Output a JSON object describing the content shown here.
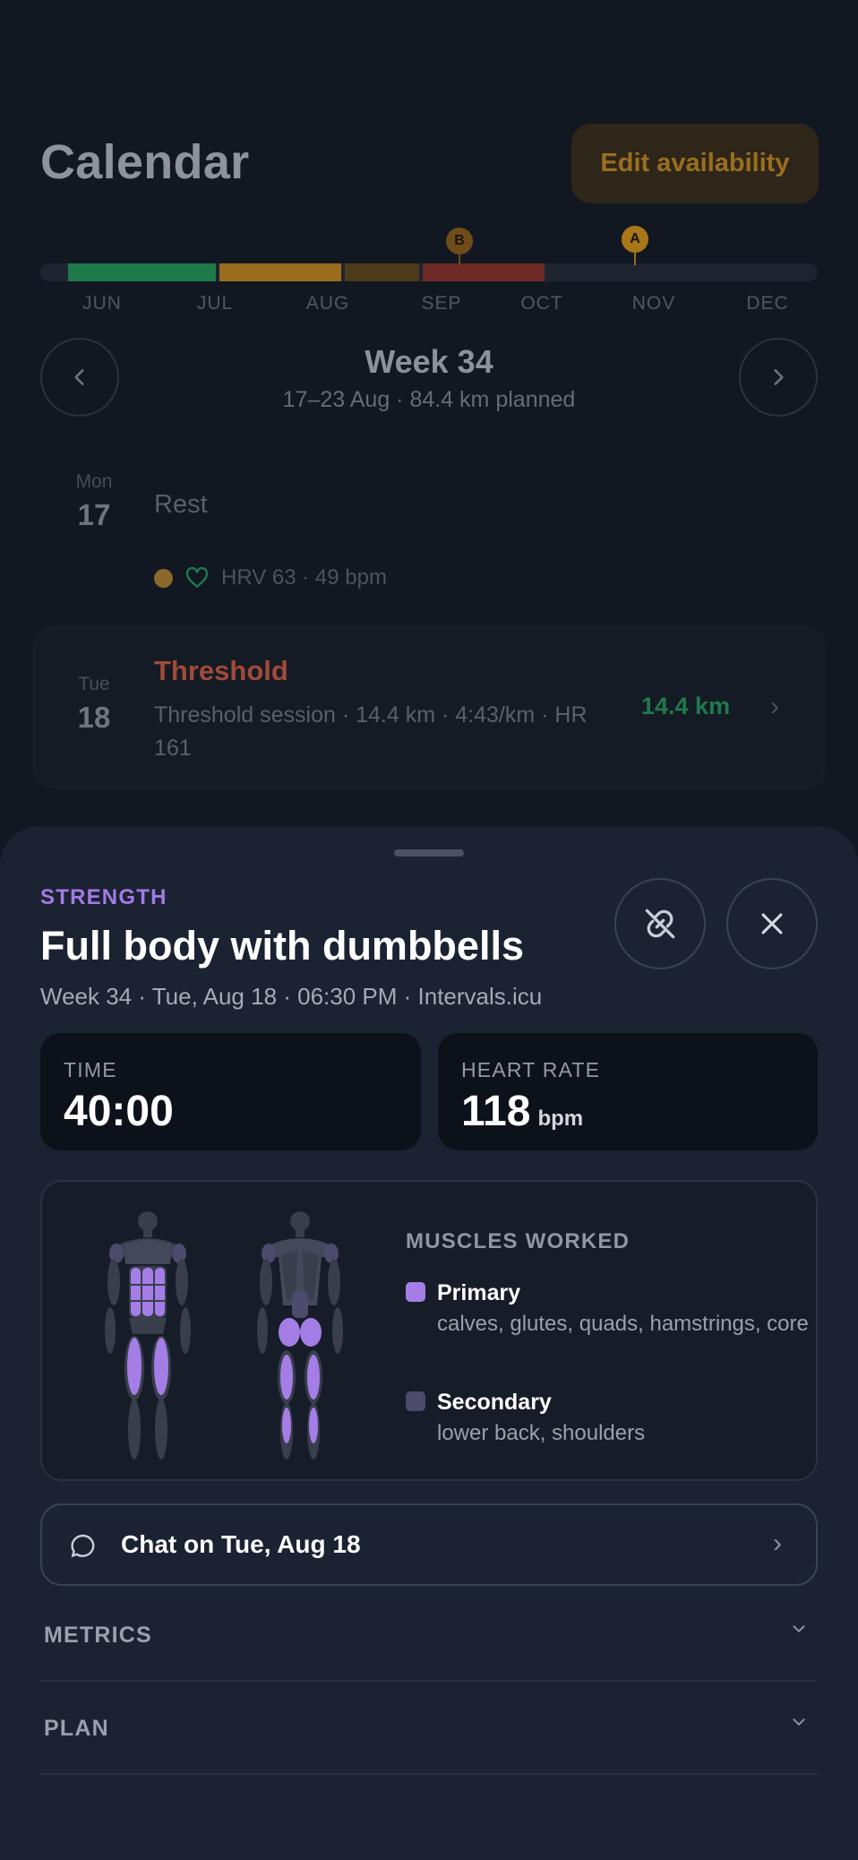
{
  "calendar": {
    "title": "Calendar",
    "edit_label": "Edit availability",
    "months": [
      "JUN",
      "JUL",
      "AUG",
      "SEP",
      "OCT",
      "NOV",
      "DEC"
    ],
    "race_markers": [
      "B",
      "A"
    ],
    "week": {
      "title": "Week 34",
      "subtitle": "17–23 Aug · 84.4 km planned",
      "prev_icon": "chevron-left-icon",
      "next_icon": "chevron-right-icon"
    },
    "days": [
      {
        "dow": "Mon",
        "num": "17",
        "title": "Rest",
        "hrv": "HRV 63 · 49 bpm"
      },
      {
        "dow": "Tue",
        "num": "18",
        "title": "Threshold",
        "desc": "Threshold session · 14.4 km · 4:43/km · HR 161",
        "distance": "14.4 km"
      }
    ]
  },
  "sheet": {
    "category": "STRENGTH",
    "title": "Full body with dumbbells",
    "meta": "Week 34 · Tue, Aug 18 · 06:30 PM · Intervals.icu",
    "unlink_icon": "unlink-icon",
    "close_icon": "close-icon",
    "stats": {
      "time_label": "TIME",
      "time_value": "40:00",
      "hr_label": "HEART RATE",
      "hr_value": "118",
      "hr_unit": "bpm"
    },
    "muscles": {
      "title": "MUSCLES WORKED",
      "primary_label": "Primary",
      "primary_list": "calves, glutes, quads, hamstrings, core",
      "secondary_label": "Secondary",
      "secondary_list": "lower back, shoulders"
    },
    "chat_label": "Chat on Tue, Aug 18",
    "sections": [
      "METRICS",
      "PLAN"
    ]
  },
  "colors": {
    "accent_purple": "#a27be6",
    "primary_muscle": "#a47ee6",
    "secondary_muscle": "#4e4a6b",
    "jun_green": "#1f7a4a",
    "jul_amber": "#9a6d1d",
    "sep_red": "#6e2a26",
    "threshold_red": "#a24a3a",
    "distance_green": "#1e7a4e"
  }
}
